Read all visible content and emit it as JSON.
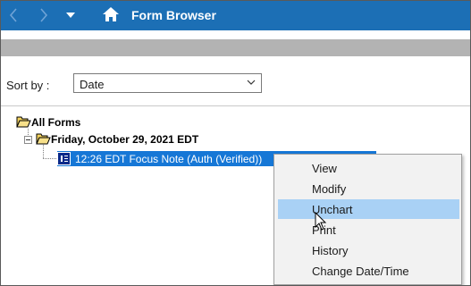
{
  "window": {
    "title": "Form Browser"
  },
  "colors": {
    "titlebar": "#1c6fb5",
    "selection": "#1677d6",
    "menu_hover": "#a9d1f5",
    "strip": "#b3b3b3"
  },
  "icons": {
    "back": "chevron-left-icon",
    "forward": "chevron-right-icon",
    "dropdown": "caret-down-icon",
    "home": "home-icon",
    "folder": "open-folder-icon",
    "document": "document-icon",
    "cursor": "mouse-pointer-icon"
  },
  "sort": {
    "label": "Sort by :",
    "value": "Date"
  },
  "tree": {
    "root": "All Forms",
    "date_node": "Friday, October 29, 2021 EDT",
    "note": "12:26 EDT Focus Note (Auth (Verified))"
  },
  "context_menu": {
    "items": [
      {
        "label": "View"
      },
      {
        "label": "Modify"
      },
      {
        "label": "Unchart",
        "hovered": true
      },
      {
        "label": "Print"
      },
      {
        "label": "History"
      },
      {
        "label": "Change Date/Time"
      }
    ]
  }
}
